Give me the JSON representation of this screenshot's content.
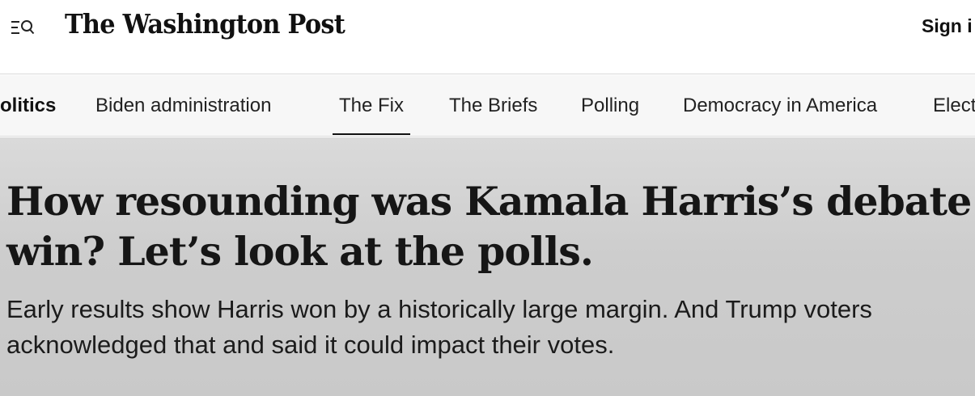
{
  "header": {
    "logo_text": "The Washington Post",
    "signin_label": "Sign i",
    "menu_icon": "menu-search-icon"
  },
  "nav": {
    "items": [
      {
        "label": "olitics"
      },
      {
        "label": "Biden administration"
      },
      {
        "label": "The Fix"
      },
      {
        "label": "The Briefs"
      },
      {
        "label": "Polling"
      },
      {
        "label": "Democracy in America"
      },
      {
        "label": "Elect"
      }
    ],
    "active": "The Fix"
  },
  "article": {
    "headline": "How resounding was Kamala Harris’s debate win? Let’s look at the polls.",
    "dek": "Early results show Harris won by a historically large margin. And Trump voters acknowledged that and said it could impact their votes."
  },
  "colors": {
    "text": "#111111",
    "hero_bg": "#cccccc",
    "nav_bg": "#f7f7f7"
  }
}
